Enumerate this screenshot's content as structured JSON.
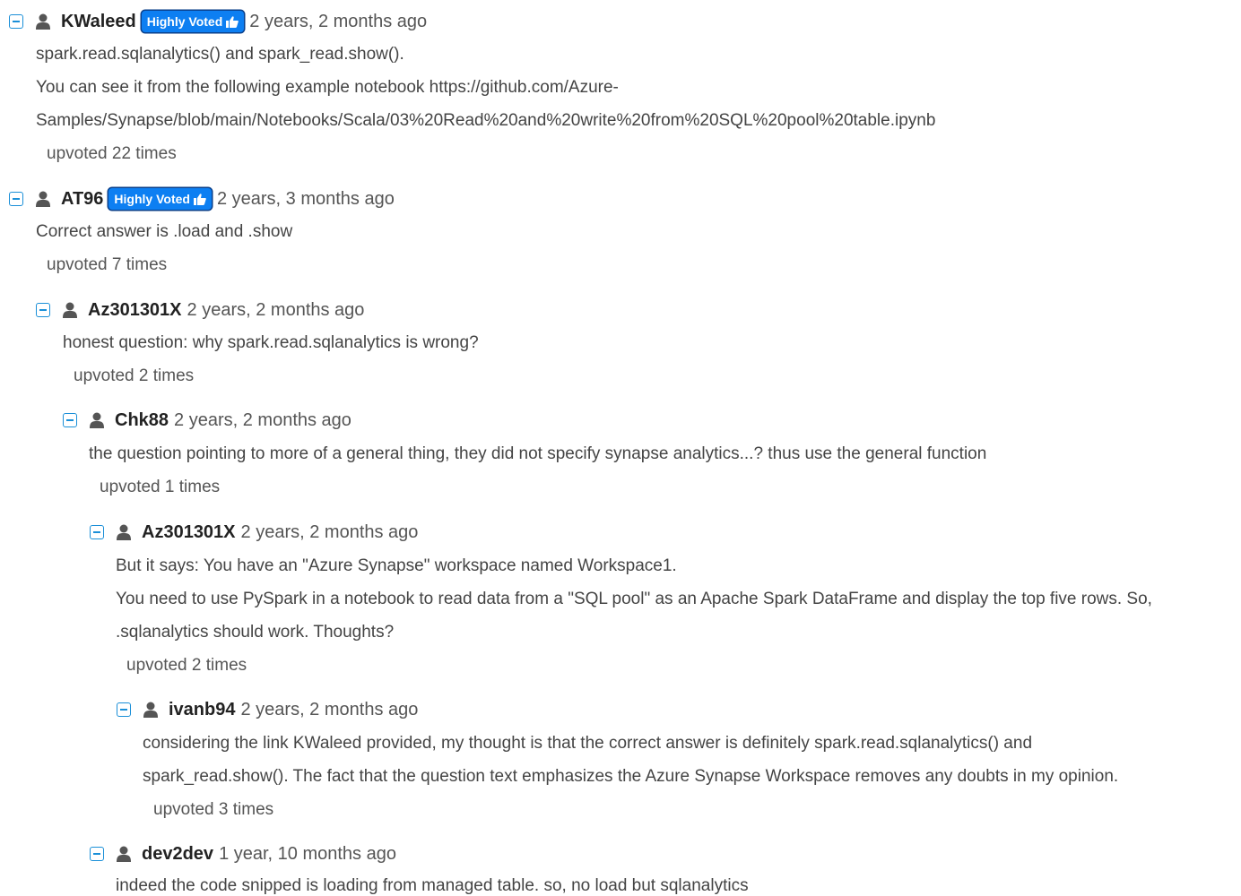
{
  "badge_label": "Highly Voted",
  "comments": [
    {
      "user": "KWaleed",
      "time": "2 years, 2 months ago",
      "lines": [
        "spark.read.sqlanalytics() and spark_read.show().",
        "You can see it from the following example notebook https://github.com/Azure-",
        "Samples/Synapse/blob/main/Notebooks/Scala/03%20Read%20and%20write%20from%20SQL%20pool%20table.ipynb"
      ],
      "upvotes": "upvoted 22 times"
    },
    {
      "user": "AT96",
      "time": "2 years, 3 months ago",
      "lines": [
        "Correct answer is .load and .show"
      ],
      "upvotes": "upvoted 7 times"
    },
    {
      "user": "Az301301X",
      "time": "2 years, 2 months ago",
      "lines": [
        "honest question: why spark.read.sqlanalytics is wrong?"
      ],
      "upvotes": "upvoted 2 times"
    },
    {
      "user": "Chk88",
      "time": "2 years, 2 months ago",
      "lines": [
        "the question pointing to more of a general thing, they did not specify synapse analytics...? thus use the general function"
      ],
      "upvotes": "upvoted 1 times"
    },
    {
      "user": "Az301301X",
      "time": "2 years, 2 months ago",
      "lines": [
        "But it says: You have an \"Azure Synapse\" workspace named Workspace1.",
        "You need to use PySpark in a notebook to read data from a \"SQL pool\" as an Apache Spark DataFrame and display the top five rows. So,",
        ".sqlanalytics should work. Thoughts?"
      ],
      "upvotes": "upvoted 2 times"
    },
    {
      "user": "ivanb94",
      "time": "2 years, 2 months ago",
      "lines": [
        "considering the link KWaleed provided, my thought is that the correct answer is definitely spark.read.sqlanalytics() and",
        "spark_read.show(). The fact that the question text emphasizes the Azure Synapse Workspace removes any doubts in my opinion."
      ],
      "upvotes": "upvoted 3 times"
    },
    {
      "user": "dev2dev",
      "time": "1 year, 10 months ago",
      "lines": [
        "indeed the code snipped is loading from managed table. so, no load but sqlanalytics"
      ],
      "upvotes": ""
    }
  ]
}
